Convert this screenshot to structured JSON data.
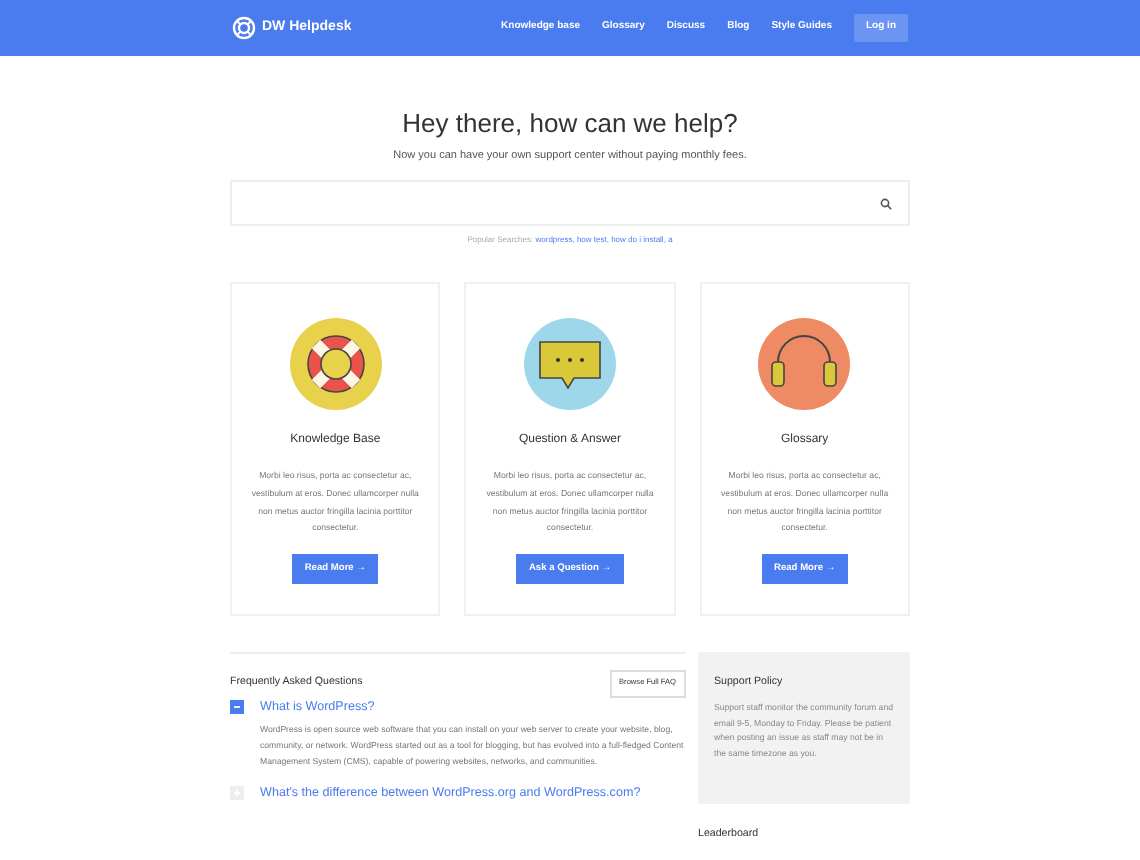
{
  "header": {
    "logo": "DW Helpdesk",
    "nav": [
      "Knowledge base",
      "Glossary",
      "Discuss",
      "Blog",
      "Style Guides"
    ],
    "login": "Log in"
  },
  "hero": {
    "title": "Hey there, how can we help?",
    "subtitle": "Now you can have your own support center without paying monthly fees.",
    "popular_label": "Popular Searches:",
    "popular_links": [
      "wordpress,",
      "how test,",
      "how do i install,",
      "a"
    ]
  },
  "cards": [
    {
      "kind": "lifebuoy",
      "title": "Knowledge Base",
      "text": "Morbi leo risus, porta ac consectetur ac, vestibulum at eros. Donec ullamcorper nulla non metus auctor fringilla lacinia porttitor consectetur.",
      "button": "Read More →"
    },
    {
      "kind": "chat",
      "title": "Question & Answer",
      "text": "Morbi leo risus, porta ac consectetur ac, vestibulum at eros. Donec ullamcorper nulla non metus auctor fringilla lacinia porttitor consectetur.",
      "button": "Ask a Question →"
    },
    {
      "kind": "headphones",
      "title": "Glossary",
      "text": "Morbi leo risus, porta ac consectetur ac, vestibulum at eros. Donec ullamcorper nulla non metus auctor fringilla lacinia porttitor consectetur.",
      "button": "Read More →"
    }
  ],
  "faq": {
    "title": "Frequently Asked Questions",
    "browse": "Browse Full FAQ",
    "items": [
      {
        "question": "What is WordPress?",
        "expanded": true,
        "answer": "WordPress is open source web software that you can install on your web server to create your website, blog, community, or network. WordPress started out as a tool for blogging, but has evolved into a full-fledged Content Management System (CMS), capable of powering websites, networks, and communities."
      },
      {
        "question": "What's the difference between WordPress.org and WordPress.com?",
        "expanded": false
      }
    ]
  },
  "sidebar": {
    "policy_title": "Support Policy",
    "policy_text": "Support staff monitor the community forum and email 9-5, Monday to Friday. Please be patient when posting an issue as staff may not be in the same timezone as you.",
    "leaderboard": "Leaderboard"
  }
}
